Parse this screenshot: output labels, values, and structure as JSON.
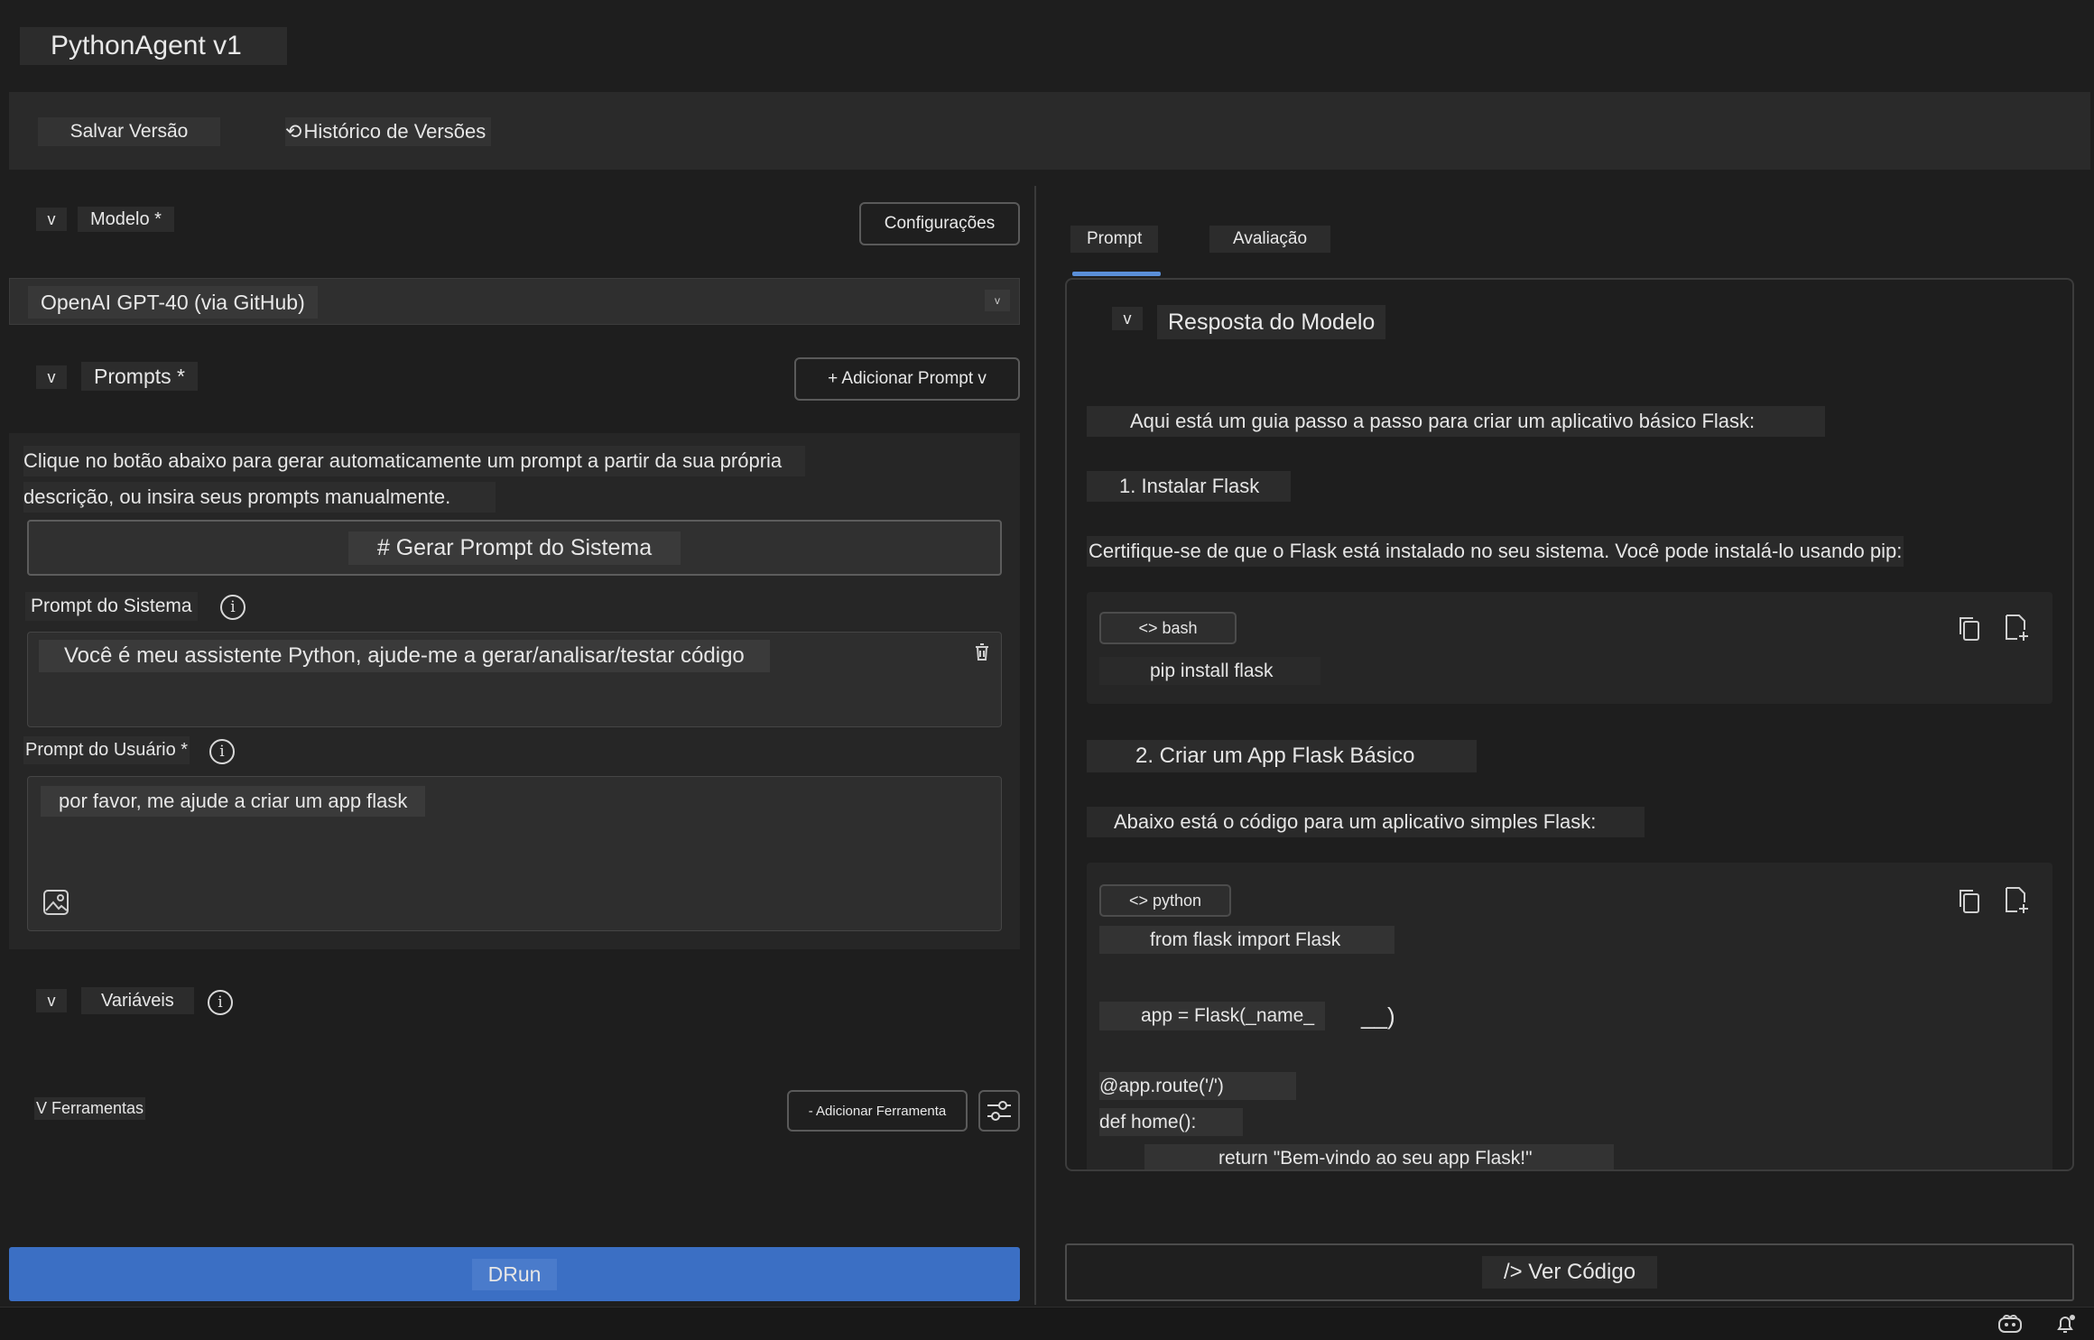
{
  "app": {
    "title": "PythonAgent v1"
  },
  "toolbar": {
    "save_label": "Salvar Versão",
    "history_label": "Histórico de Versões"
  },
  "left": {
    "model": {
      "toggle": "v",
      "label": "Modelo *",
      "config_label": "Configurações",
      "selected": "OpenAI GPT-40 (via GitHub)",
      "select_arrow": "v"
    },
    "prompts": {
      "toggle": "v",
      "label": "Prompts *",
      "add_label": "+ Adicionar Prompt v",
      "helper_line1": "Clique no botão abaixo para gerar automaticamente um prompt a partir da sua própria",
      "helper_line2": "descrição, ou insira seus prompts manualmente.",
      "generate_label": "# Gerar Prompt do Sistema",
      "system_label": "Prompt do Sistema",
      "system_value": "Você é meu assistente Python, ajude-me a gerar/analisar/testar código",
      "user_label": "Prompt do Usuário *",
      "user_value": "por favor, me ajude a criar um app flask"
    },
    "variables": {
      "toggle": "v",
      "label": "Variáveis"
    },
    "tools": {
      "label": "V Ferramentas",
      "add_label": "- Adicionar Ferramenta"
    },
    "run_label": "DRun"
  },
  "right": {
    "tabs": [
      {
        "label": "Prompt",
        "active": true
      },
      {
        "label": "Avaliação",
        "active": false
      }
    ],
    "response": {
      "toggle": "v",
      "title": "Resposta do Modelo",
      "intro": "Aqui está um guia passo a passo para criar um aplicativo básico Flask:",
      "step1": "1. Instalar Flask",
      "step1_text": "Certifique-se de que o Flask está instalado no seu sistema. Você pode instalá-lo usando pip:",
      "code1": {
        "lang": "<> bash",
        "lines": [
          "pip install flask"
        ]
      },
      "step2": "2. Criar um App Flask Básico",
      "step2_text": "Abaixo está o código para um aplicativo simples Flask:",
      "code2": {
        "lang": "<> python",
        "line1": "from flask import Flask",
        "line2": "app = Flask(_name_",
        "line2_end": "__)",
        "line3": "@app.route('/')",
        "line4": "def home():",
        "line5": "return \"Bem-vindo ao seu app Flask!\""
      }
    },
    "view_code_label": "/> Ver Código"
  },
  "accent_color": "#3b6fc4"
}
